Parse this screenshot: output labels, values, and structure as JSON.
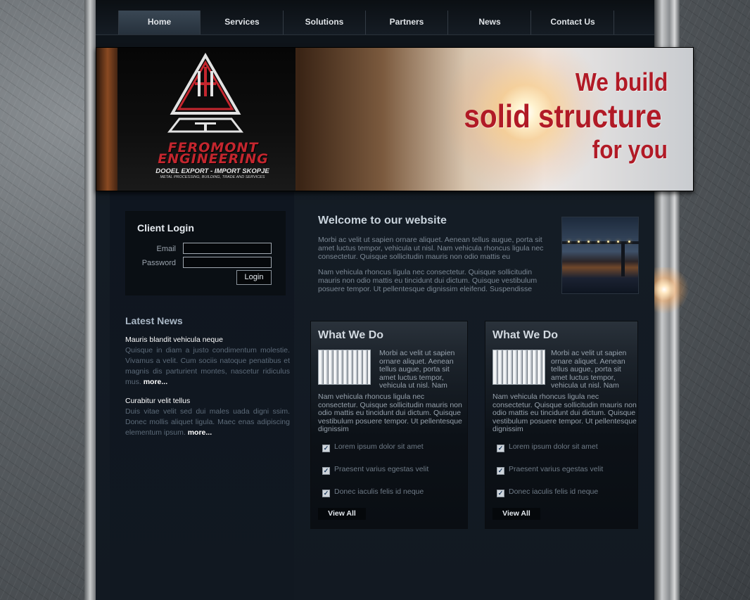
{
  "nav": {
    "items": [
      "Home",
      "Services",
      "Solutions",
      "Partners",
      "News",
      "Contact Us"
    ],
    "active": "Home"
  },
  "banner": {
    "company_name": "FEROMONT ENGINEERING",
    "company_line1": "DOOEL   EXPORT - IMPORT  SKOPJE",
    "company_line2": "METAL PROCESSING, BUILDING, TRADE AND SERVICES",
    "tagline_1": "We build",
    "tagline_2": "solid structure",
    "tagline_3": "for you"
  },
  "login": {
    "title": "Client Login",
    "email_label": "Email",
    "password_label": "Password",
    "email_value": "",
    "password_value": "",
    "button": "Login"
  },
  "news": {
    "title": "Latest News",
    "items": [
      {
        "headline": "Mauris blandit vehicula neque",
        "body": "Quisque in diam a justo condimentum molestie. Vivamus a velit. Cum sociis natoque penatibus et magnis dis parturient montes, nascetur ridiculus mus.",
        "more": "more..."
      },
      {
        "headline": "Curabitur velit tellus",
        "body": "Duis vitae velit sed dui males uada digni ssim. Donec mollis aliquet ligula. Maec enas adipiscing elementum ipsum.",
        "more": "more..."
      }
    ]
  },
  "welcome": {
    "title": "Welcome to our website",
    "para1": "Morbi ac velit ut sapien ornare aliquet. Aenean tellus augue, porta sit amet luctus tempor, vehicula ut nisl. Nam vehicula rhoncus ligula nec consectetur. Quisque sollicitudin mauris non odio mattis eu",
    "para2": "Nam vehicula rhoncus ligula nec consectetur. Quisque sollicitudin mauris non odio mattis eu tincidunt dui dictum. Quisque vestibulum posuere tempor. Ut pellentesque dignissim eleifend. Suspendisse"
  },
  "cards": [
    {
      "title": "What We Do",
      "intro": "Morbi ac velit ut sapien ornare aliquet. Aenean tellus augue, porta sit amet luctus tempor, vehicula ut nisl. Nam",
      "body": "Nam vehicula rhoncus ligula nec consectetur. Quisque sollicitudin mauris non odio mattis eu tincidunt dui dictum. Quisque vestibulum posuere tempor. Ut pellentesque dignissim",
      "checks": [
        "Lorem ipsum dolor sit amet",
        "Praesent varius egestas velit",
        "Donec iaculis felis id neque"
      ],
      "button": "View All"
    },
    {
      "title": "What We Do",
      "intro": "Morbi ac velit ut sapien ornare aliquet. Aenean tellus augue, porta sit amet luctus tempor, vehicula ut nisl. Nam",
      "body": "Nam vehicula rhoncus ligula nec consectetur. Quisque sollicitudin mauris non odio mattis eu tincidunt dui dictum. Quisque vestibulum posuere tempor. Ut pellentesque dignissim",
      "checks": [
        "Lorem ipsum dolor sit amet",
        "Praesent varius egestas velit",
        "Donec iaculis felis id neque"
      ],
      "button": "View All"
    }
  ],
  "colors": {
    "accent_red": "#b11a26",
    "page_bg": "#121922",
    "muted_text": "#5c6a78"
  },
  "icons": [
    "logo-emblem-icon",
    "checkbox-icon"
  ]
}
